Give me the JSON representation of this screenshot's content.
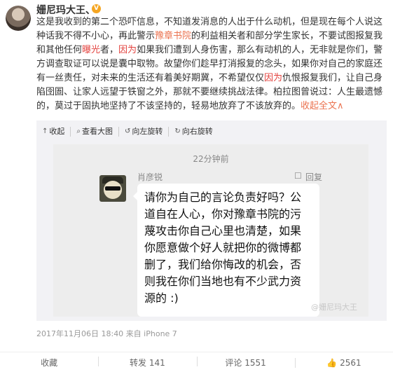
{
  "author": {
    "name": "姗尼玛大王、",
    "badge": "V"
  },
  "post": {
    "p1": "这是我收到的第二个恐吓信息，不知道发消息的人出于什么动机，但是现在每个人说这种话我不得不小心，再此警示",
    "link1": "豫章书院",
    "p2": "的利益相关者和部分学生家长，不要试图报复我和其他任何",
    "hl1": "曝光",
    "p3": "者，",
    "hl2": "因为",
    "p4": "如果我们遭到人身伤害，那么有动机的人，无非就是你们，警方调查取证可以说是囊中取物。故望你们趁早打消报复的念头，如果你对自己的家庭还有一丝责任，对未来的生活还有着美好期冀，不希望仅仅",
    "hl3": "因为",
    "p5": "仇恨报复我们，让自己身陷囹圄、让家人远望于铁窗之外，那就不要继续挑战法律。柏拉图曾说过：人生最遗憾的，莫过于固执地坚持了不该坚持的，轻易地放弃了不该放弃的。",
    "more": "收起全文",
    "more_arrow": "∧"
  },
  "toolbar": {
    "collapse": "收起",
    "view_large": "查看大图",
    "rotate_left": "向左旋转",
    "rotate_right": "向右旋转",
    "icons": {
      "collapse": "collapse-icon",
      "view_large": "magnifier-icon",
      "rotate_left": "rotate-left-icon",
      "rotate_right": "rotate-right-icon"
    }
  },
  "screenshot": {
    "time": "22分钟前",
    "sender": "肖彦锐",
    "reply": "回复",
    "message_lines": [
      "请你为自己的言论负责好吗？公",
      "道自在人心，你对豫章书院的污",
      "蔑攻击你自己心里也清楚，如果",
      "你愿意做个好人就把你的微博都",
      "删了，我们给你悔改的机会，否",
      "则我在你们当地也有不少武力资",
      "源的 :)"
    ],
    "watermark": "@姗尼玛大王"
  },
  "meta": {
    "time": "2017年11月06日 18:40",
    "source": "来自 iPhone 7"
  },
  "actions": {
    "favorite": "收藏",
    "repost_label": "转发",
    "repost_count": "141",
    "comment_label": "评论",
    "comment_count": "1551",
    "like_count": "2561"
  },
  "colors": {
    "link": "#eb7350",
    "highlight": "#e3423e",
    "badge": "#f5a623"
  }
}
